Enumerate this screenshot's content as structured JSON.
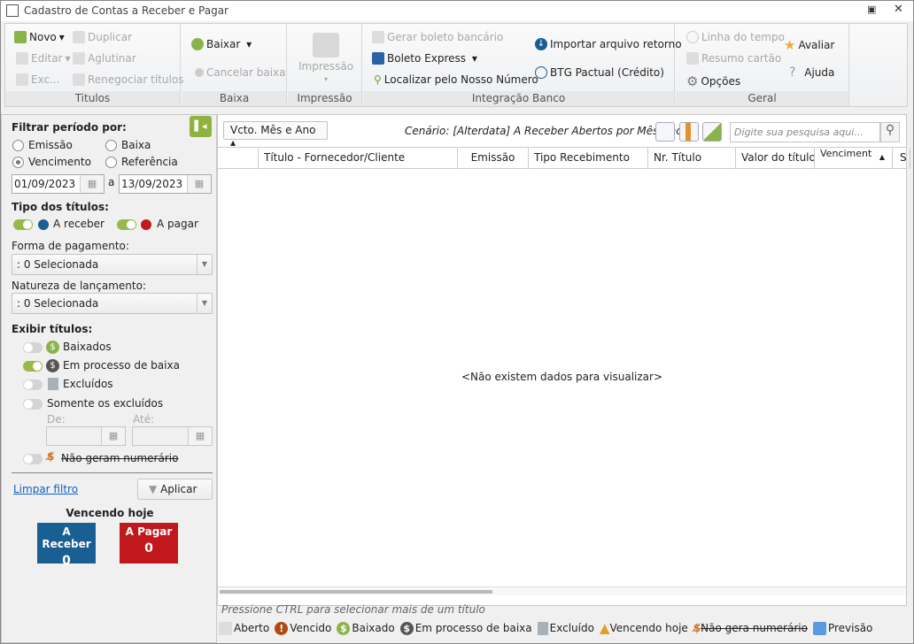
{
  "window": {
    "title": "Cadastro de Contas a Receber e Pagar"
  },
  "ribbon": {
    "titulos": {
      "label": "Titulos",
      "novo": "Novo",
      "duplicar": "Duplicar",
      "editar": "Editar",
      "aglutinar": "Aglutinar",
      "excluir": "Exc...",
      "renegociar": "Renegociar títulos"
    },
    "baixa": {
      "label": "Baixa",
      "baixar": "Baixar",
      "cancelar": "Cancelar baixa"
    },
    "impressao": {
      "label": "Impressão",
      "button": "Impressão"
    },
    "banco": {
      "label": "Integração Banco",
      "gerar": "Gerar boleto bancário",
      "boleto_express": "Boleto Express",
      "localizar": "Localizar pelo Nosso Número",
      "importar": "Importar arquivo retorno",
      "btg": "BTG Pactual (Crédito)"
    },
    "geral": {
      "label": "Geral",
      "linha": "Linha do tempo",
      "resumo": "Resumo cartão",
      "opcoes": "Opções",
      "avaliar": "Avaliar",
      "ajuda": "Ajuda"
    }
  },
  "filter": {
    "periodo_title": "Filtrar período por:",
    "radios": [
      "Emissão",
      "Baixa",
      "Vencimento",
      "Referência"
    ],
    "selected": "Vencimento",
    "date_from": "01/09/2023",
    "date_sep": "a",
    "date_to": "13/09/2023",
    "tipo_title": "Tipo dos títulos:",
    "receber": "A receber",
    "pagar": "A pagar",
    "forma_label": "Forma de pagamento:",
    "forma_value": ": 0 Selecionada",
    "natureza_label": "Natureza de lançamento:",
    "natureza_value": ": 0 Selecionada",
    "exibir_title": "Exibir títulos:",
    "baixados": "Baixados",
    "em_processo": "Em processo de baixa",
    "excluidos": "Excluídos",
    "somente": "Somente os excluídos",
    "de": "De:",
    "ate": "Até:",
    "nao_geram": "Não geram numerário",
    "limpar": "Limpar filtro",
    "aplicar": "Aplicar",
    "vencendo_title": "Vencendo hoje",
    "card_receber": "A Receber",
    "card_receber_value": "0",
    "card_pagar": "A Pagar",
    "card_pagar_value": "0"
  },
  "grid": {
    "group_button": "Vcto. Mês e Ano",
    "scenario": "Cenário: [Alterdata] A  Receber Abertos por Mês/Ano",
    "search_placeholder": "Digite sua pesquisa aqui...",
    "columns": [
      "Título - Fornecedor/Cliente",
      "Emissão",
      "Tipo Recebimento",
      "Nr. Título",
      "Valor do título",
      "Venciment",
      "S"
    ],
    "empty": "<Não existem dados para visualizar>"
  },
  "footer": {
    "hint": "Pressione CTRL para selecionar mais de um título",
    "legend": [
      "Aberto",
      "Vencido",
      "Baixado",
      "Em processo de baixa",
      "Excluído",
      "Vencendo hoje",
      "Não gera numerário",
      "Previsão"
    ]
  },
  "colors": {
    "green": "#9ab84a",
    "blue": "#1a5f94",
    "red": "#c0181c"
  }
}
